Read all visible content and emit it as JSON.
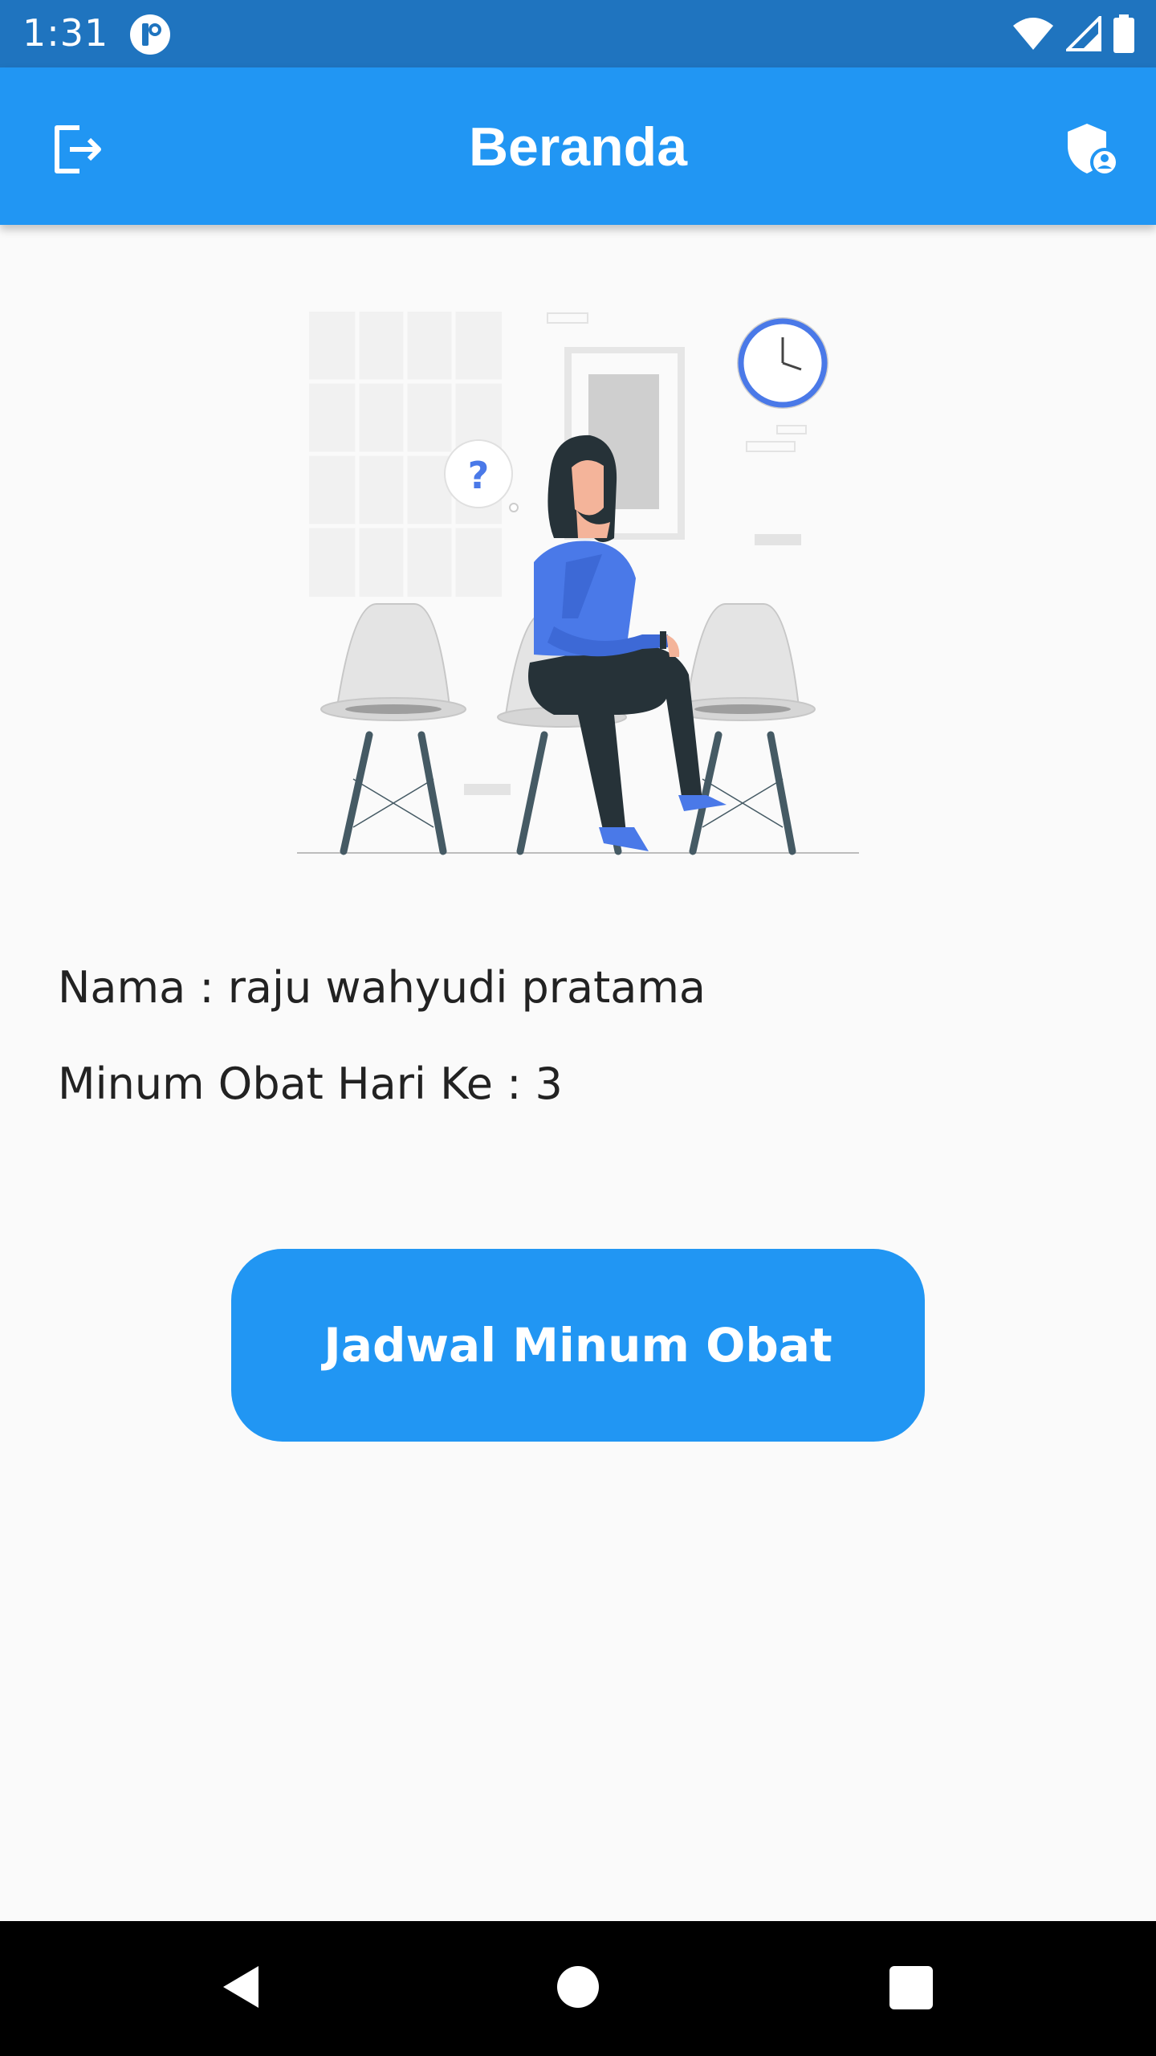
{
  "status_bar": {
    "time": "1:31",
    "icons": [
      "app-notification-icon",
      "wifi-icon",
      "signal-icon",
      "battery-icon"
    ]
  },
  "app_bar": {
    "title": "Beranda",
    "left_icon": "logout-icon",
    "right_icon": "admin-shield-icon",
    "color": "#2196f3"
  },
  "illustration": {
    "icon": "waiting-woman-illustration"
  },
  "user_info": {
    "nama": "Nama : raju wahyudi pratama",
    "hari": "Minum Obat Hari Ke : 3"
  },
  "actions": {
    "jadwal_label": "Jadwal Minum Obat"
  },
  "nav_bar": {
    "icons": [
      "back-icon",
      "home-icon",
      "recents-icon"
    ]
  }
}
